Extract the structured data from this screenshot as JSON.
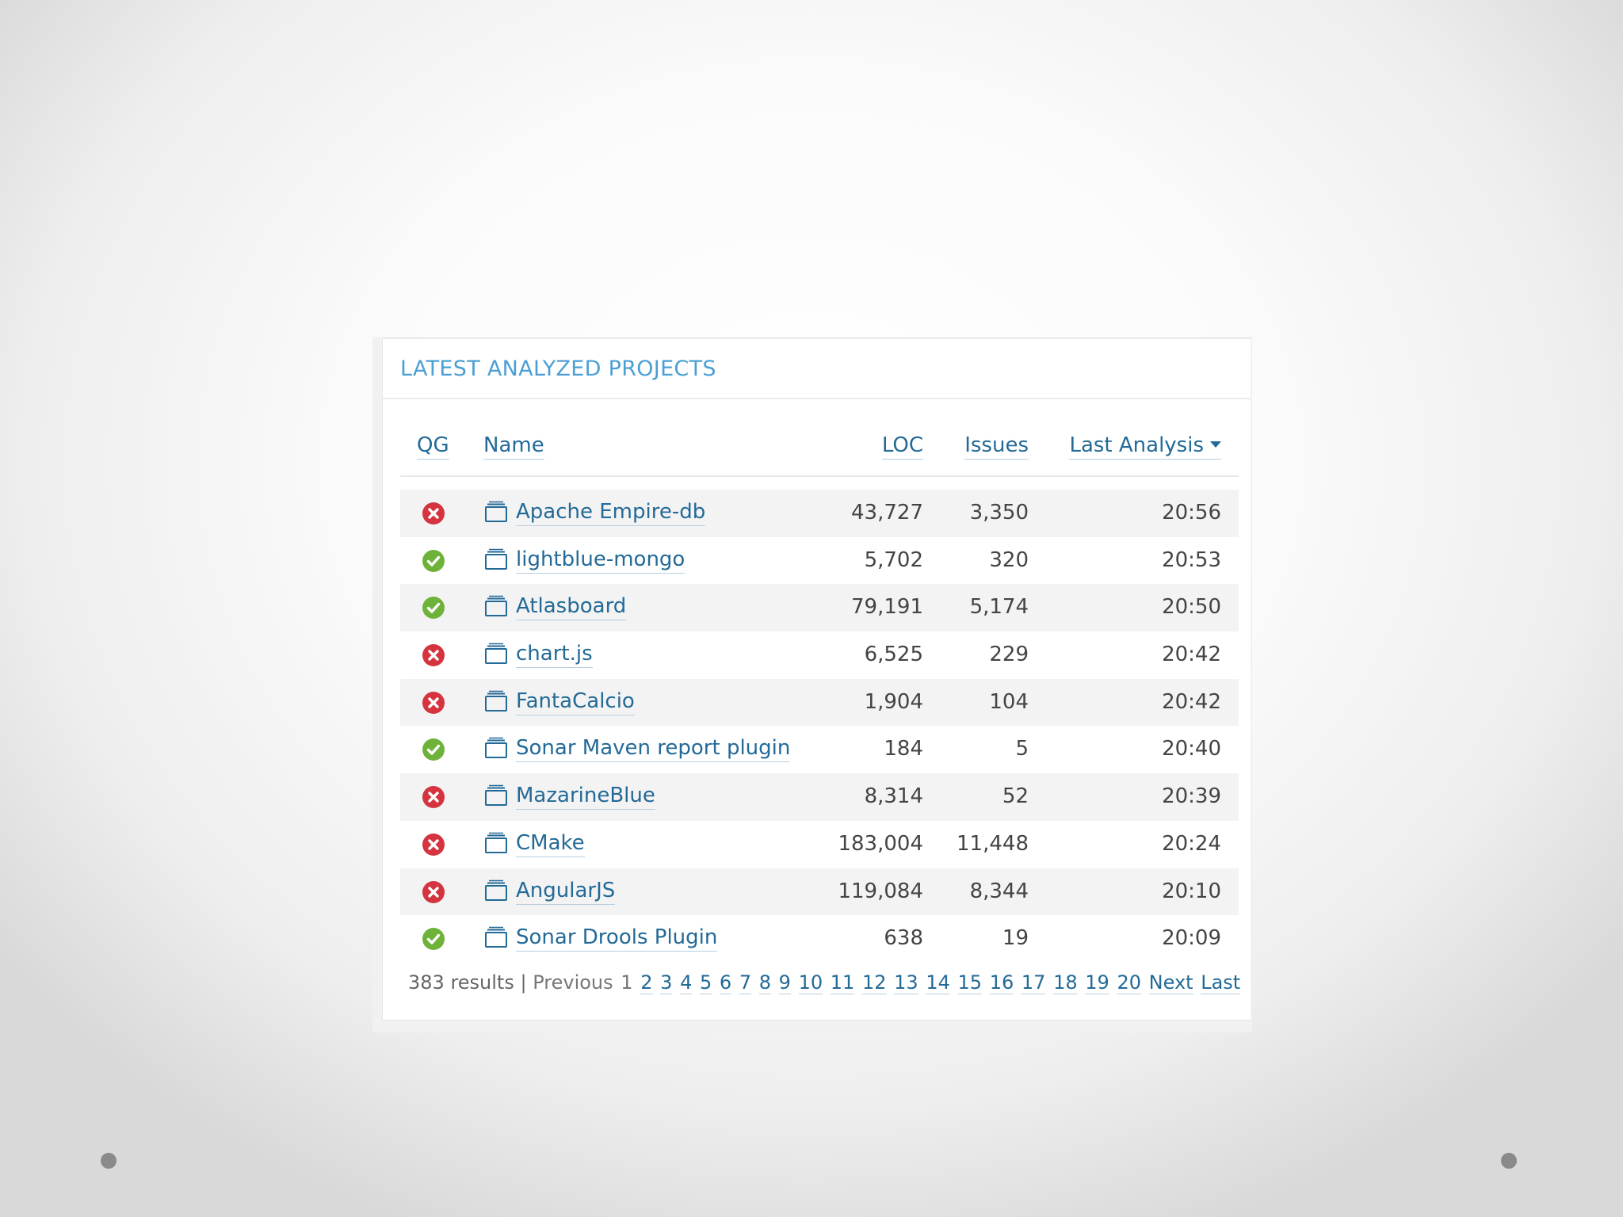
{
  "widget": {
    "title": "LATEST ANALYZED PROJECTS"
  },
  "columns": {
    "qg": "QG",
    "name": "Name",
    "loc": "LOC",
    "issues": "Issues",
    "last_analysis": "Last Analysis"
  },
  "projects": [
    {
      "status": "error",
      "name": "Apache Empire-db",
      "loc": "43,727",
      "issues": "3,350",
      "time": "20:56"
    },
    {
      "status": "ok",
      "name": "lightblue-mongo",
      "loc": "5,702",
      "issues": "320",
      "time": "20:53"
    },
    {
      "status": "ok",
      "name": "Atlasboard",
      "loc": "79,191",
      "issues": "5,174",
      "time": "20:50"
    },
    {
      "status": "error",
      "name": "chart.js",
      "loc": "6,525",
      "issues": "229",
      "time": "20:42"
    },
    {
      "status": "error",
      "name": "FantaCalcio",
      "loc": "1,904",
      "issues": "104",
      "time": "20:42"
    },
    {
      "status": "ok",
      "name": "Sonar Maven report plugin",
      "loc": "184",
      "issues": "5",
      "time": "20:40"
    },
    {
      "status": "error",
      "name": "MazarineBlue",
      "loc": "8,314",
      "issues": "52",
      "time": "20:39"
    },
    {
      "status": "error",
      "name": "CMake",
      "loc": "183,004",
      "issues": "11,448",
      "time": "20:24"
    },
    {
      "status": "error",
      "name": "AngularJS",
      "loc": "119,084",
      "issues": "8,344",
      "time": "20:10"
    },
    {
      "status": "ok",
      "name": "Sonar Drools Plugin",
      "loc": "638",
      "issues": "19",
      "time": "20:09"
    }
  ],
  "pagination": {
    "results": "383 results",
    "separator": "|",
    "previous": "Previous",
    "current": "1",
    "pages": [
      "2",
      "3",
      "4",
      "5",
      "6",
      "7",
      "8",
      "9",
      "10",
      "11",
      "12",
      "13",
      "14",
      "15",
      "16",
      "17",
      "18",
      "19",
      "20"
    ],
    "next": "Next",
    "last": "Last"
  },
  "colors": {
    "ok": "#6fb23a",
    "error": "#d4333f",
    "link": "#236a97",
    "title": "#4b9fd5"
  }
}
